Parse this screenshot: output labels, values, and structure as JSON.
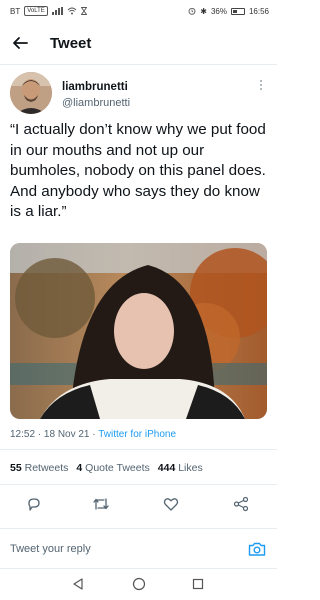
{
  "status_bar": {
    "carrier": "BT",
    "network_badge": "VoLTE",
    "battery_percent": "36%",
    "time": "16:56",
    "icons": [
      "signal-icon",
      "wifi-icon",
      "hourglass-icon",
      "alarm-icon",
      "bluetooth-icon",
      "battery-icon"
    ]
  },
  "header": {
    "title": "Tweet",
    "back_icon": "back-arrow-icon"
  },
  "author": {
    "name": "liambrunetti",
    "handle": "@liambrunetti"
  },
  "tweet": {
    "text": "“I actually don’t know why we put food in our mouths and not up our bumholes, nobody on this panel does. And anybody who says they do know is a liar.”",
    "timestamp": "12:52 · 18 Nov 21 · ",
    "source": "Twitter for iPhone"
  },
  "stats": {
    "retweets_count": "55",
    "retweets_label": "Retweets",
    "quote_count": "4",
    "quote_label": "Quote Tweets",
    "likes_count": "444",
    "likes_label": "Likes"
  },
  "actions": [
    "reply-icon",
    "retweet-icon",
    "like-icon",
    "share-icon"
  ],
  "reply_bar": {
    "placeholder": "Tweet your reply"
  },
  "nav": [
    "back-triangle-icon",
    "home-circle-icon",
    "recents-square-icon"
  ],
  "colors": {
    "accent": "#1d9bf0",
    "text": "#0f1419",
    "secondary": "#536471",
    "divider": "#e6ecf0"
  }
}
